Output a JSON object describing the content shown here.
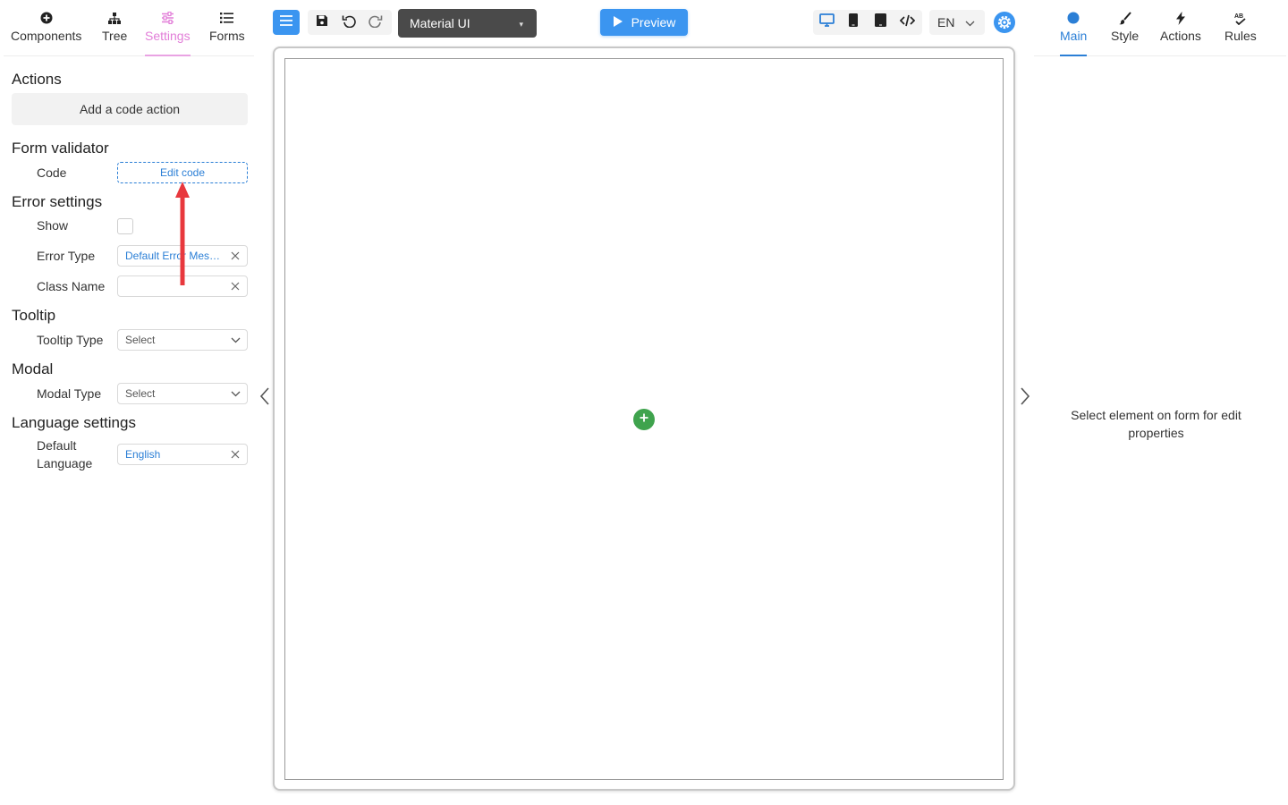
{
  "left_panel": {
    "tabs": [
      {
        "label": "Components",
        "icon": "plus-circle-icon"
      },
      {
        "label": "Tree",
        "icon": "tree-icon"
      },
      {
        "label": "Settings",
        "icon": "sliders-icon",
        "active": true
      },
      {
        "label": "Forms",
        "icon": "list-icon"
      }
    ],
    "actions": {
      "title": "Actions",
      "add_button": "Add a code action"
    },
    "form_validator": {
      "title": "Form validator",
      "code_label": "Code",
      "edit_button": "Edit code"
    },
    "error_settings": {
      "title": "Error settings",
      "show_label": "Show",
      "show_checked": false,
      "error_type_label": "Error Type",
      "error_type_value": "Default Error Message",
      "class_name_label": "Class Name",
      "class_name_value": ""
    },
    "tooltip": {
      "title": "Tooltip",
      "type_label": "Tooltip Type",
      "type_placeholder": "Select"
    },
    "modal": {
      "title": "Modal",
      "type_label": "Modal Type",
      "type_placeholder": "Select"
    },
    "language_settings": {
      "title": "Language settings",
      "default_label_line1": "Default",
      "default_label_line2": "Language",
      "default_value": "English"
    }
  },
  "toolbar": {
    "theme": "Material UI",
    "preview_label": "Preview",
    "language": "EN",
    "icons": [
      "menu-icon",
      "save-icon",
      "undo-icon",
      "redo-icon",
      "desktop-icon",
      "tablet-icon",
      "mobile-icon",
      "code-icon",
      "gear-icon"
    ]
  },
  "right_panel": {
    "tabs": [
      {
        "label": "Main",
        "icon": "circle-icon",
        "active": true
      },
      {
        "label": "Style",
        "icon": "brush-icon"
      },
      {
        "label": "Actions",
        "icon": "bolt-icon"
      },
      {
        "label": "Rules",
        "icon": "spellcheck-icon"
      }
    ],
    "empty_message": "Select element on form for edit properties"
  },
  "colors": {
    "accent_blue": "#3b95f0",
    "settings_tab_pink": "#e27ed8",
    "annotation_red": "#e8383d",
    "add_button_green": "#3fa34d"
  }
}
